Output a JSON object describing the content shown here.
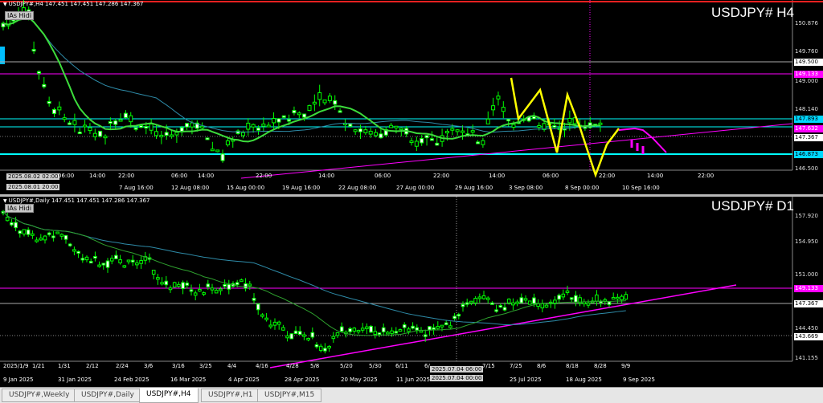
{
  "h4": {
    "header": "USDJPY#,H4  147.451 147.451 147.286 147.367",
    "title": "USDJPY# H4",
    "ashidi": "IAs Hidi",
    "prices": {
      "p1": "150.876",
      "p2": "149.760",
      "p3": "149.500",
      "p4": "149.133",
      "p5": "149.000",
      "p6": "148.140",
      "p7": "147.893",
      "p8": "147.632",
      "p9": "147.367",
      "p10": "146.873",
      "p11": "146.500"
    },
    "time_labels": [
      "06:00",
      "14:00",
      "22:00",
      "7 Aug 16:00",
      "06:00",
      "14:00",
      "12 Aug 08:00",
      "22:00",
      "15 Aug 00:00",
      "14:00",
      "19 Aug 16:00",
      "06:00",
      "22 Aug 08:00",
      "22:00",
      "27 Aug 00:00",
      "14:00",
      "29 Aug 16:00",
      "06:00",
      "3 Sep 08:00",
      "22:00",
      "8 Sep 00:00",
      "14:00",
      "10 Sep 16:00",
      "22:00"
    ],
    "date_box_top": "2025.08.02 02:00",
    "date_box_bottom": "2025.08.01 20:00",
    "first_time": "2025.08.02"
  },
  "d1": {
    "header": "USDJPY#,Daily  147.451 147.451 147.286 147.367",
    "title": "USDJPY# D1",
    "ashidi": "IAs Hidi",
    "prices": {
      "p1": "157.920",
      "p2": "154.950",
      "p3": "151.000",
      "p4": "149.133",
      "p5": "147.367",
      "p6": "144.450",
      "p7": "143.669",
      "p8": "141.155"
    },
    "upper_labels": [
      "2025/1/9",
      "1/21",
      "1/31",
      "2/12",
      "2/24",
      "3/6",
      "3/16",
      "3/25",
      "4/4",
      "4/16",
      "4/28",
      "5/8",
      "5/20",
      "5/30",
      "6/11",
      "6/",
      "7/15",
      "7/25",
      "8/6",
      "8/18",
      "8/28",
      "9/9"
    ],
    "lower_labels": [
      "9 Jan 2025",
      "31 Jan 2025",
      "24 Feb 2025",
      "16 Mar 2025",
      "4 Apr 2025",
      "28 Apr 2025",
      "20 May 2025",
      "11 Jun 2025",
      "25 Jul 2025",
      "18 Aug 2025",
      "9 Sep 2025"
    ],
    "date_box_top": "2025.07.04 06:00",
    "date_box_bottom": "2025.07.04 00:00"
  },
  "tabs": [
    "USDJPY#,Weekly",
    "USDJPY#,Daily",
    "USDJPY#,H4",
    "USDJPY#,H1",
    "USDJPY#,M15"
  ],
  "active_tab": "USDJPY#,H4",
  "colors": {
    "bull": "#ffffff",
    "bear": "#000000",
    "candle_green": "#00ff00",
    "ma_fast": "#32cd32",
    "ma_slow": "#1e90ff",
    "magenta": "#ff00ff",
    "cyan": "#00ffff",
    "yellow": "#ffff00"
  }
}
